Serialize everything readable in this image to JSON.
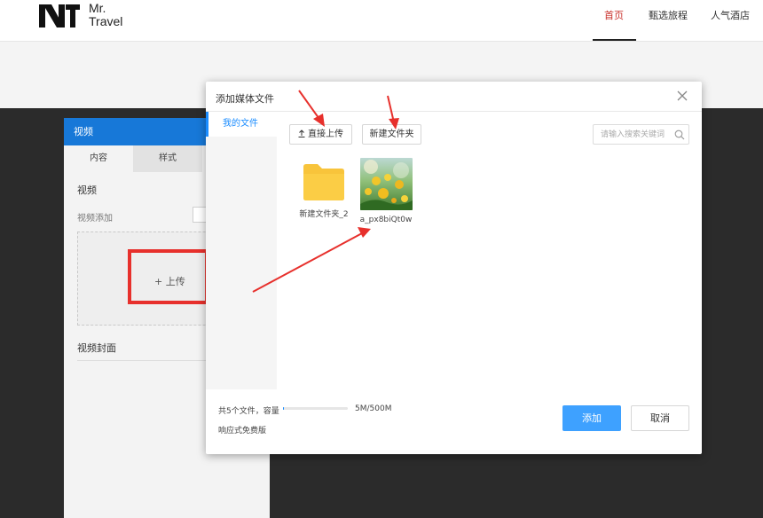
{
  "site": {
    "logo_line1": "Mr.",
    "logo_line2": "Travel",
    "nav": [
      "首页",
      "甄选旅程",
      "人气酒店"
    ]
  },
  "panel": {
    "title": "视频",
    "tabs": [
      "内容",
      "样式"
    ],
    "section_video": "视频",
    "video_add_label": "视频添加",
    "upload_label": "+ 上传",
    "section_cover": "视频封面"
  },
  "modal": {
    "title": "添加媒体文件",
    "sidebar_items": [
      "我的文件"
    ],
    "upload_button": "直接上传",
    "new_folder_button": "新建文件夹",
    "search_placeholder": "请输入搜索关键词",
    "files": [
      {
        "name": "新建文件夹_2",
        "type": "folder"
      },
      {
        "name": "a_px8biQt0w",
        "type": "image"
      }
    ],
    "footer": {
      "file_count": "共5个文件，容量",
      "quota_text": "5M/500M",
      "quota_fraction": 0.01,
      "plan": "响应式免费版"
    },
    "add_button": "添加",
    "cancel_button": "取消"
  },
  "colors": {
    "accent": "#1a8cff",
    "primary_button": "#3ea1ff",
    "panel_header": "#1778d8",
    "annotation_red": "#e7302c",
    "folder": "#f8c43b",
    "nav_active": "#c8302b"
  },
  "icons": {
    "close": "close-icon",
    "upload": "upload-icon",
    "search": "search-icon",
    "folder": "folder-icon"
  }
}
